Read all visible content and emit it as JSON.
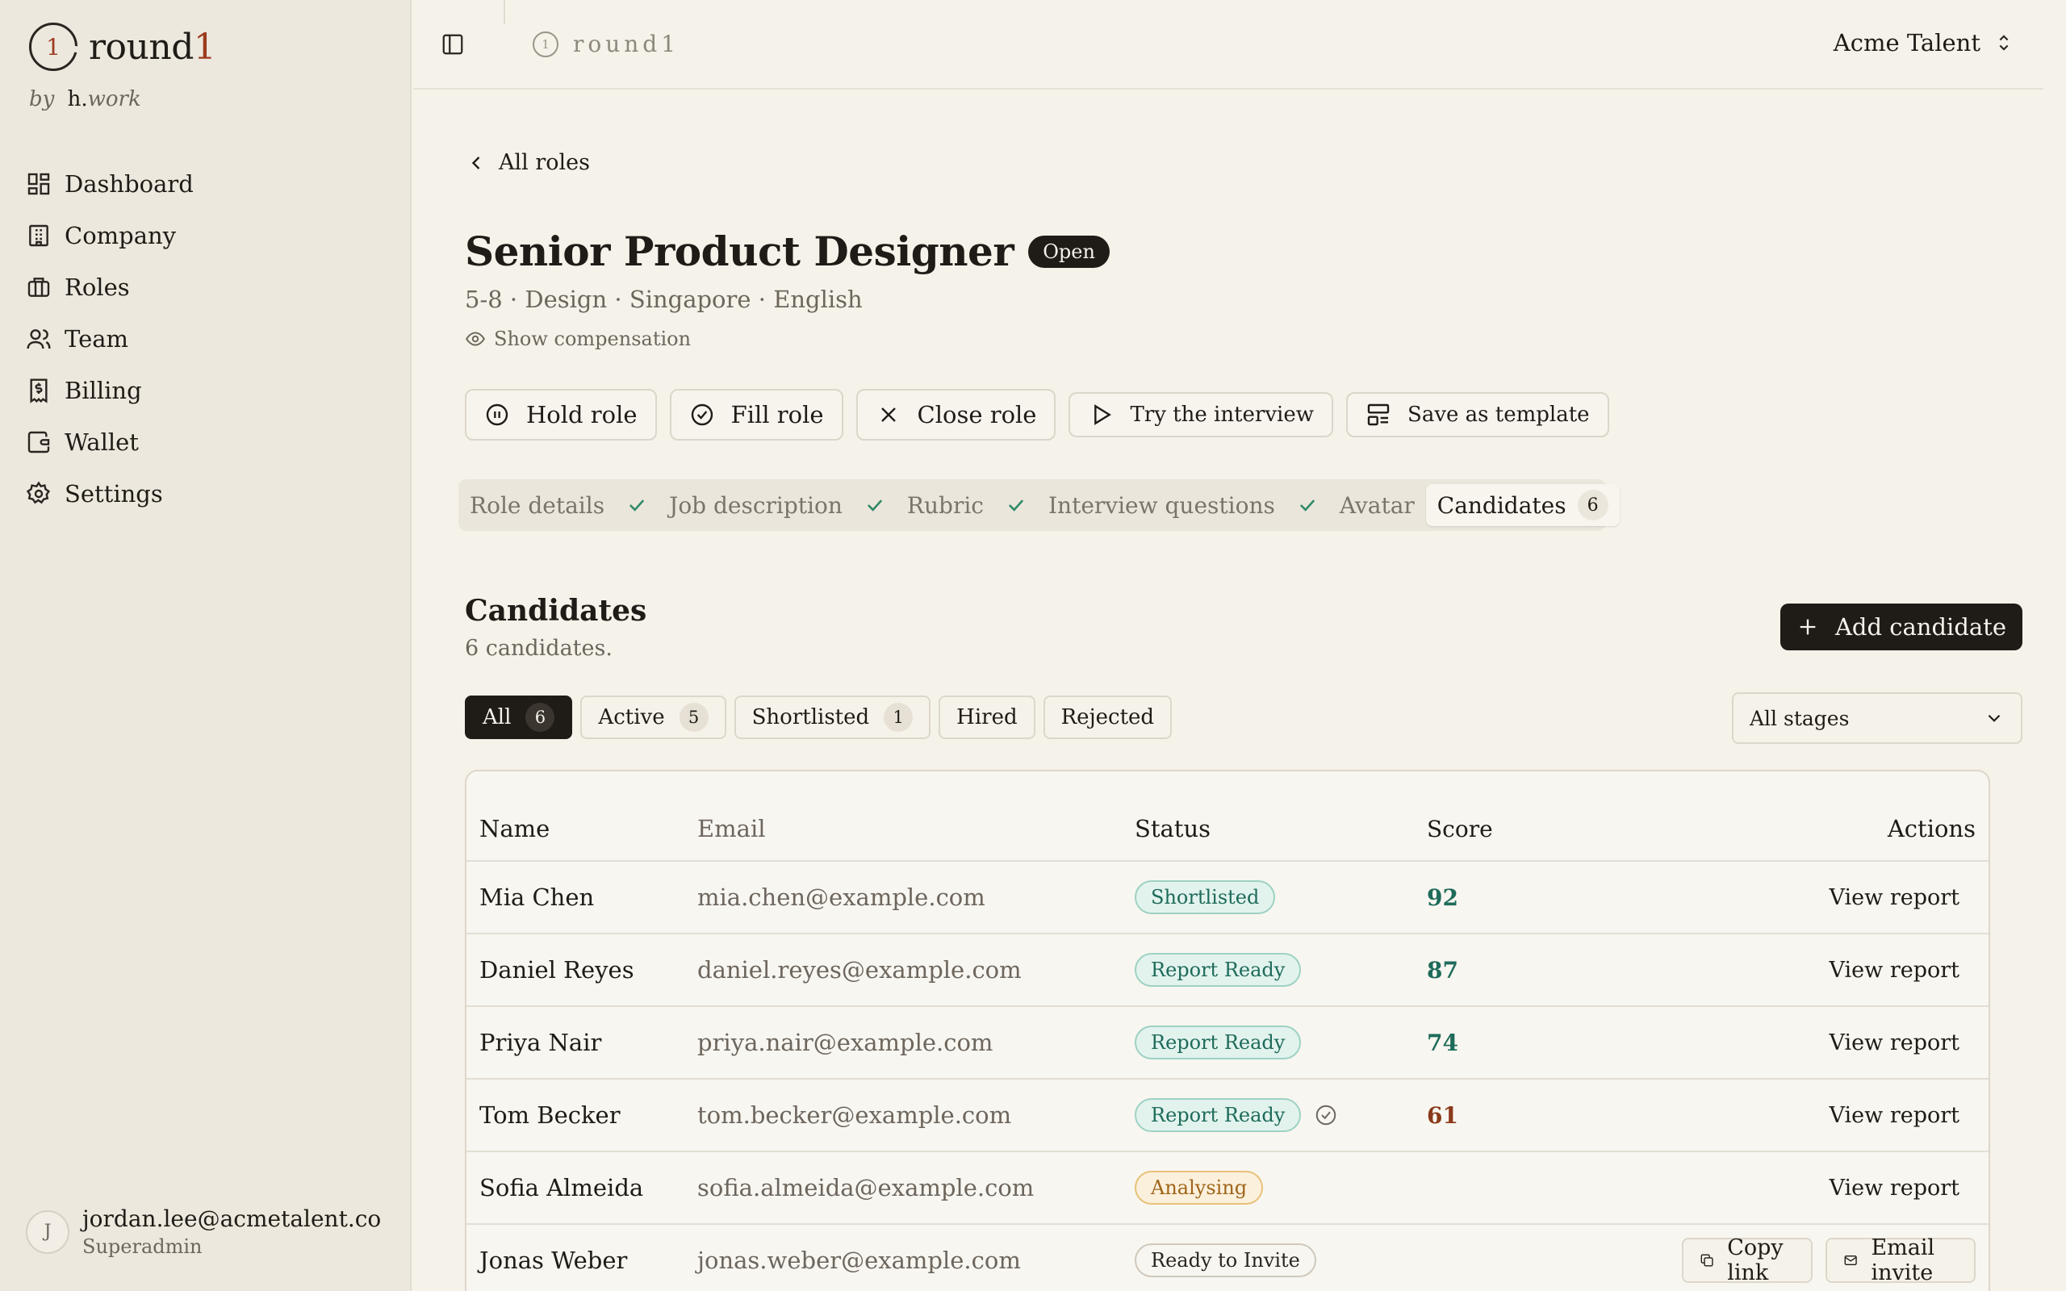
{
  "brand": {
    "name": "round",
    "number": "1",
    "mark": "1",
    "by": "by",
    "maker": "h.",
    "maker_suffix": "work"
  },
  "nav": [
    {
      "label": "Dashboard",
      "icon": "dashboard-icon"
    },
    {
      "label": "Company",
      "icon": "building-icon"
    },
    {
      "label": "Roles",
      "icon": "briefcase-icon"
    },
    {
      "label": "Team",
      "icon": "users-icon"
    },
    {
      "label": "Billing",
      "icon": "receipt-icon"
    },
    {
      "label": "Wallet",
      "icon": "wallet-icon"
    },
    {
      "label": "Settings",
      "icon": "gear-icon"
    }
  ],
  "user": {
    "initial": "J",
    "email": "jordan.lee@acmetalent.co",
    "role": "Superadmin"
  },
  "topbar": {
    "app_name": "round1",
    "mark": "1",
    "workspace": "Acme Talent"
  },
  "back_label": "All roles",
  "role": {
    "title": "Senior Product Designer",
    "status": "Open",
    "meta": "5-8 · Design · Singapore · English",
    "show_comp": "Show compensation"
  },
  "actions": [
    {
      "label": "Hold role",
      "icon": "pause-icon"
    },
    {
      "label": "Fill role",
      "icon": "check-circle-icon"
    },
    {
      "label": "Close role",
      "icon": "close-icon"
    },
    {
      "label": "Try the interview",
      "icon": "play-icon"
    },
    {
      "label": "Save as template",
      "icon": "template-icon"
    }
  ],
  "steps": [
    {
      "label": "Role details",
      "done": true
    },
    {
      "label": "Job description",
      "done": true
    },
    {
      "label": "Rubric",
      "done": true
    },
    {
      "label": "Interview questions",
      "done": true
    },
    {
      "label": "Avatar",
      "done": false
    },
    {
      "label": "Candidates",
      "count": "6",
      "active": true
    }
  ],
  "candidates": {
    "heading": "Candidates",
    "subtitle": "6 candidates.",
    "add_label": "Add candidate",
    "filters": [
      {
        "label": "All",
        "count": "6"
      },
      {
        "label": "Active",
        "count": "5"
      },
      {
        "label": "Shortlisted",
        "count": "1"
      },
      {
        "label": "Hired"
      },
      {
        "label": "Rejected"
      }
    ],
    "stage_select": "All stages",
    "columns": {
      "name": "Name",
      "email": "Email",
      "status": "Status",
      "score": "Score",
      "actions": "Actions"
    },
    "rows": [
      {
        "name": "Mia Chen",
        "email": "mia.chen@example.com",
        "status": "Shortlisted",
        "score": "92",
        "action": "View report"
      },
      {
        "name": "Daniel Reyes",
        "email": "daniel.reyes@example.com",
        "status": "Report Ready",
        "score": "87",
        "action": "View report"
      },
      {
        "name": "Priya Nair",
        "email": "priya.nair@example.com",
        "status": "Report Ready",
        "score": "74",
        "action": "View report"
      },
      {
        "name": "Tom Becker",
        "email": "tom.becker@example.com",
        "status": "Report Ready",
        "score": "61",
        "action": "View report"
      },
      {
        "name": "Sofia Almeida",
        "email": "sofia.almeida@example.com",
        "status": "Analysing",
        "score": "",
        "action": "View report"
      },
      {
        "name": "Jonas Weber",
        "email": "jonas.weber@example.com",
        "status": "Ready to Invite",
        "score": "",
        "copy_link": "Copy link",
        "email_invite": "Email invite"
      }
    ]
  },
  "colors": {
    "accent": "#9c3b1f",
    "score_high": "#1e6b5a",
    "score_low": "#8a3a1a",
    "teal": "#1e6b5a",
    "amber": "#a0651a"
  }
}
